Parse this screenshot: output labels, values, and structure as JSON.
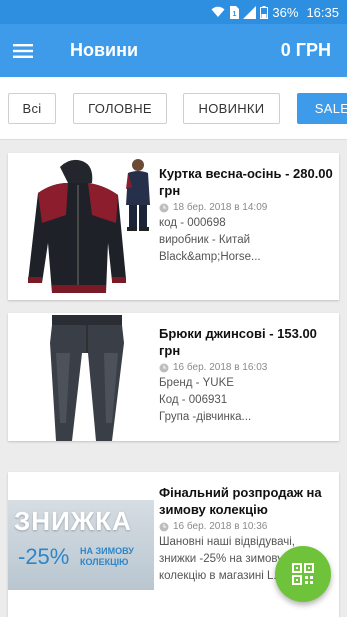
{
  "status_bar": {
    "battery": "36%",
    "time": "16:35"
  },
  "app_bar": {
    "title": "Новини",
    "cart_total": "0 ГРН",
    "menu_icon": "hamburger-menu-icon"
  },
  "filters": [
    {
      "label": "Всі",
      "active": false
    },
    {
      "label": "ГОЛОВНЕ",
      "active": false
    },
    {
      "label": "НОВИНКИ",
      "active": false
    },
    {
      "label": "SALE",
      "active": true
    }
  ],
  "news": [
    {
      "title": "Куртка весна-осінь - 280.00 грн",
      "date": "18 бер. 2018 в 14:09",
      "lines": [
        "код - 000698",
        "виробник - Китай",
        "Black&amp;Horse..."
      ]
    },
    {
      "title": "Брюки джинсові - 153.00 грн",
      "date": "16 бер. 2018 в 16:03",
      "lines": [
        "Бренд  - YUKE",
        "Код -  006931",
        "Група   -дівчинка..."
      ]
    },
    {
      "title": "Фінальний розпродаж на зимову колекцію",
      "date": "16 бер. 2018 в 10:36",
      "lines": [
        "Шановні наші відвідувачі,",
        "знижки -25% на зимову",
        "колекцію в магазині L..."
      ],
      "banner": {
        "headline": "ЗНИЖКА",
        "discount": "-25%",
        "caption_line1": "НА ЗИМОВУ",
        "caption_line2": "КОЛЕКЦІЮ"
      }
    }
  ],
  "fab": {
    "icon": "qr-code-icon"
  },
  "colors": {
    "primary": "#3d9bea",
    "status_bar": "#2e8fe0",
    "fab": "#6fc33a"
  }
}
